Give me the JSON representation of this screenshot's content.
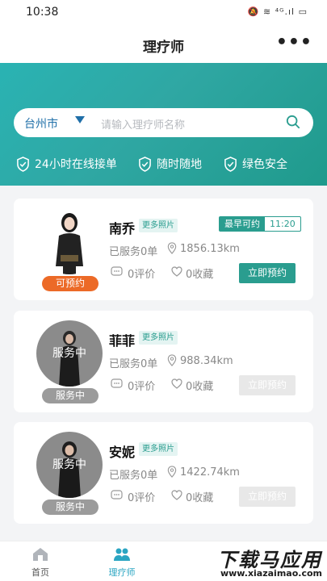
{
  "status_bar": {
    "time": "10:38",
    "icons": "🔕 ≋ ⁴ᴳ.ıl ▭"
  },
  "nav": {
    "title": "理疗师",
    "more": "•••"
  },
  "search": {
    "city": "台州市",
    "placeholder": "请输入理疗师名称"
  },
  "features": [
    {
      "label": "24小时在线接单"
    },
    {
      "label": "随时随地"
    },
    {
      "label": "绿色安全"
    }
  ],
  "therapists": [
    {
      "name": "南乔",
      "more_photos": "更多照片",
      "earliest_label": "最早可约",
      "earliest_time": "11:20",
      "status_pill": "可预约",
      "avatar_overlay": "",
      "served": "已服务0单",
      "distance": "1856.13km",
      "reviews": "0评价",
      "favorites": "0收藏",
      "book": "立即预约"
    },
    {
      "name": "菲菲",
      "more_photos": "更多照片",
      "status_pill": "服务中",
      "avatar_overlay": "服务中",
      "served": "已服务0单",
      "distance": "988.34km",
      "reviews": "0评价",
      "favorites": "0收藏",
      "book": "立即预约"
    },
    {
      "name": "安妮",
      "more_photos": "更多照片",
      "status_pill": "服务中",
      "avatar_overlay": "服务中",
      "served": "已服务0单",
      "distance": "1422.74km",
      "reviews": "0评价",
      "favorites": "0收藏",
      "book": "立即预约"
    }
  ],
  "tabs": [
    {
      "label": "首页",
      "icon": "home-icon",
      "active": false
    },
    {
      "label": "理疗师",
      "icon": "therapist-icon",
      "active": true
    }
  ],
  "watermark": {
    "title": "下载马应用",
    "url": "www.xiazaimao.com"
  },
  "colors": {
    "teal": "#2a9d8f",
    "orange": "#ec6a27",
    "gray": "#9b9b9b"
  }
}
